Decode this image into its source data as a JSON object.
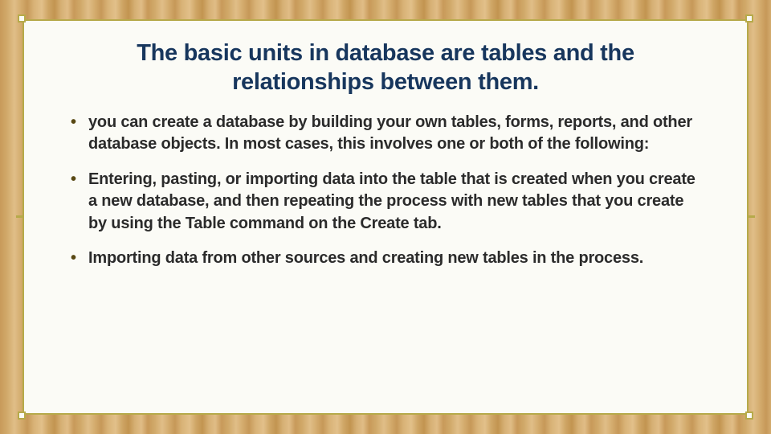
{
  "slide": {
    "title": "The basic units in database are tables and the relationships between them.",
    "bullets": [
      "you can create a database by building your own tables, forms, reports, and other database objects. In most cases, this involves one or both of the following:",
      "Entering, pasting, or importing data into the table that is created when you create a new database, and then repeating the process with new tables that you create by using the Table command on the Create tab.",
      "Importing data from other sources and creating new tables in the process."
    ]
  }
}
